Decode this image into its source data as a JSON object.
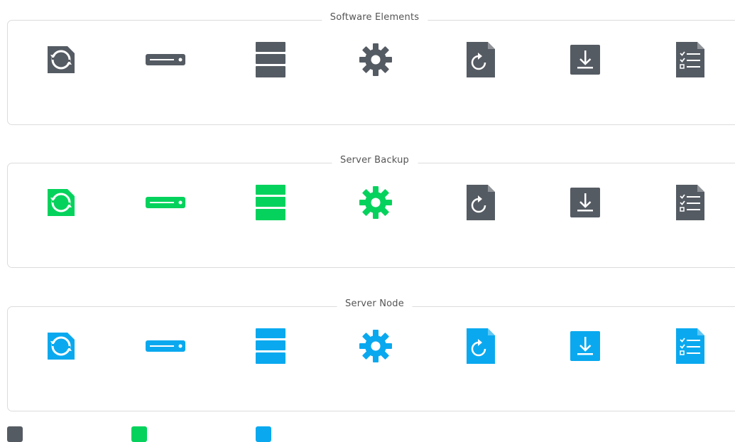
{
  "colors": {
    "gray": "#555b63",
    "green": "#05d25c",
    "blue": "#0aa9ef"
  },
  "groups": [
    {
      "title": "Software Elements",
      "subtitle": "",
      "color": "gray",
      "items": [
        {
          "icon": "sync-icon",
          "label": ""
        },
        {
          "icon": "device-icon",
          "label": ""
        },
        {
          "icon": "storage-icon",
          "label": ""
        },
        {
          "icon": "gear-icon",
          "label": ""
        },
        {
          "icon": "restore-file-icon",
          "label": ""
        },
        {
          "icon": "download-icon",
          "label": ""
        },
        {
          "icon": "checklist-icon",
          "label": ""
        }
      ]
    },
    {
      "title": "Server Backup",
      "subtitle": "",
      "color": "green",
      "items": [
        {
          "icon": "sync-icon",
          "label": ""
        },
        {
          "icon": "device-icon",
          "label": ""
        },
        {
          "icon": "storage-icon",
          "label": ""
        },
        {
          "icon": "gear-icon",
          "label": ""
        },
        {
          "icon": "restore-file-icon",
          "label": ""
        },
        {
          "icon": "download-icon",
          "label": ""
        },
        {
          "icon": "checklist-icon",
          "label": ""
        }
      ]
    },
    {
      "title": "Server Node",
      "subtitle": "",
      "color": "blue",
      "items": [
        {
          "icon": "sync-icon",
          "label": ""
        },
        {
          "icon": "device-icon",
          "label": ""
        },
        {
          "icon": "storage-icon",
          "label": ""
        },
        {
          "icon": "gear-icon",
          "label": ""
        },
        {
          "icon": "restore-file-icon",
          "label": ""
        },
        {
          "icon": "download-icon",
          "label": ""
        },
        {
          "icon": "checklist-icon",
          "label": ""
        }
      ]
    }
  ],
  "legend": [
    {
      "color": "gray",
      "label": ""
    },
    {
      "color": "green",
      "label": ""
    },
    {
      "color": "blue",
      "label": ""
    }
  ]
}
